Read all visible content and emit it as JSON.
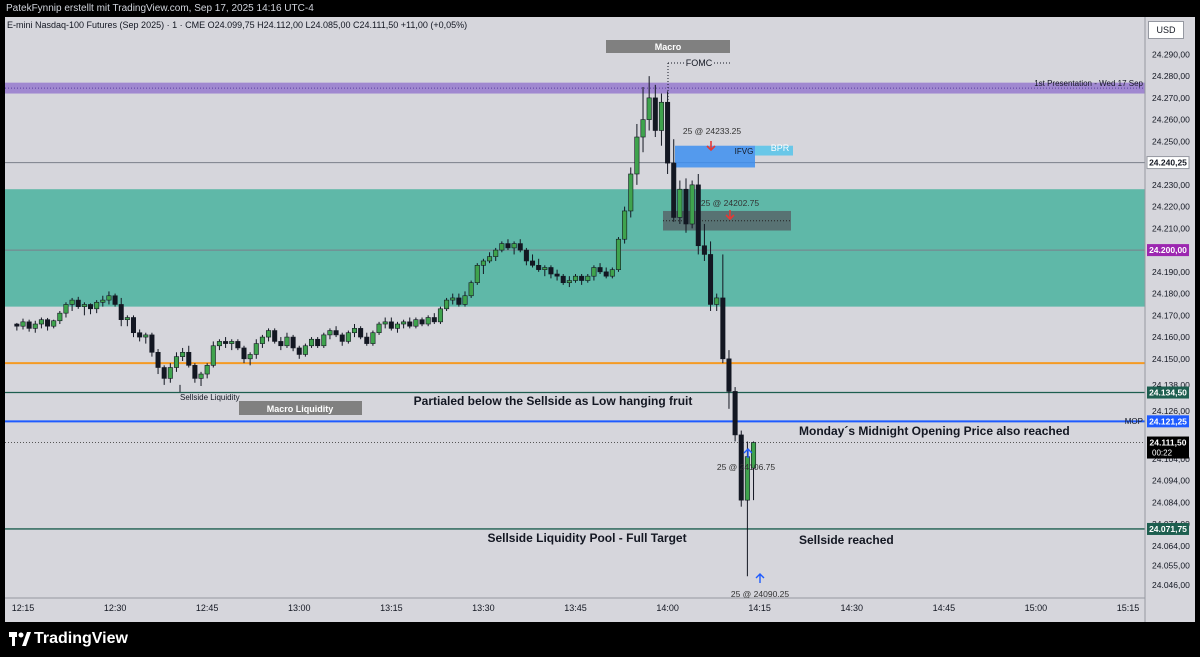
{
  "header": {
    "author_line": "PatekFynnip erstellt mit TradingView.com, Sep 17, 2025 14:16 UTC-4",
    "legend": "E-mini Nasdaq-100 Futures (Sep 2025) · 1 · CME  O24.099,75  H24.112,00  L24.085,00  C24.111,50  +11,00 (+0,05%)",
    "currency": "USD"
  },
  "footer": {
    "brand": "TradingView",
    "logo": "tradingview-logo-icon"
  },
  "colors": {
    "plot_bg": "#d6d6dc",
    "up": "#3fa34d",
    "down": "#131722",
    "zone": "#5fb8a8",
    "purple_band": "#9d84cf",
    "orange_line": "#f59a23",
    "blue_line": "#1e5bff",
    "dark_green_line": "#1d5e4f",
    "macro_box": "#808080"
  },
  "chart_data": {
    "type": "candlestick",
    "timeframe": "1",
    "y_ticks": [
      "24.290,00",
      "24.280,00",
      "24.270,00",
      "24.260,00",
      "24.250,00",
      "24.230,00",
      "24.220,00",
      "24.210,00",
      "24.190,00",
      "24.180,00",
      "24.170,00",
      "24.160,00",
      "24.150,00",
      "24.138,00",
      "24.126,00",
      "24.104,00",
      "24.094,00",
      "24.084,00",
      "24.074,00",
      "24.064,00",
      "24.055,00",
      "24.046,00"
    ],
    "x_ticks": [
      "12:15",
      "12:30",
      "12:45",
      "13:00",
      "13:15",
      "13:30",
      "13:45",
      "14:00",
      "14:15",
      "14:30",
      "14:45",
      "15:00",
      "15:15"
    ],
    "ylim": [
      24040,
      24298
    ],
    "x_tick_minutes": [
      735,
      750,
      765,
      780,
      795,
      810,
      825,
      840,
      855,
      870,
      885,
      900,
      915
    ],
    "candles_start_minute": 734,
    "candles": [
      [
        24166,
        24166.5,
        24163,
        24165
      ],
      [
        24165,
        24168.5,
        24163.5,
        24167
      ],
      [
        24167,
        24168,
        24162.5,
        24164
      ],
      [
        24164,
        24167.5,
        24162,
        24166
      ],
      [
        24166,
        24169,
        24164,
        24168
      ],
      [
        24168,
        24168.8,
        24163,
        24165
      ],
      [
        24165,
        24168,
        24164,
        24167.5
      ],
      [
        24167.5,
        24172,
        24166,
        24171
      ],
      [
        24171,
        24176,
        24169,
        24175
      ],
      [
        24175,
        24178,
        24172,
        24177
      ],
      [
        24177,
        24178.5,
        24173,
        24174
      ],
      [
        24174,
        24176,
        24170,
        24175
      ],
      [
        24175,
        24175.5,
        24170.5,
        24173
      ],
      [
        24173,
        24177,
        24171,
        24176
      ],
      [
        24176,
        24179,
        24174,
        24177
      ],
      [
        24177,
        24181,
        24175,
        24179
      ],
      [
        24179,
        24180,
        24174,
        24175
      ],
      [
        24175,
        24178,
        24165,
        24168
      ],
      [
        24168,
        24170,
        24165,
        24169
      ],
      [
        24169,
        24170,
        24160,
        24162
      ],
      [
        24162,
        24163.5,
        24158,
        24160
      ],
      [
        24160,
        24162,
        24157,
        24161
      ],
      [
        24161,
        24162,
        24151,
        24153
      ],
      [
        24153,
        24154.5,
        24143,
        24146
      ],
      [
        24146,
        24147,
        24138,
        24141
      ],
      [
        24141,
        24148,
        24139,
        24146
      ],
      [
        24146,
        24153,
        24144,
        24151
      ],
      [
        24151,
        24155,
        24149,
        24153
      ],
      [
        24153,
        24156,
        24146,
        24147
      ],
      [
        24147,
        24148,
        24139,
        24141
      ],
      [
        24141,
        24144,
        24137.5,
        24143
      ],
      [
        24143,
        24148,
        24141,
        24147
      ],
      [
        24147,
        24158,
        24146,
        24156
      ],
      [
        24156,
        24159,
        24154,
        24158
      ],
      [
        24158,
        24160,
        24155,
        24157
      ],
      [
        24157,
        24159,
        24154,
        24158
      ],
      [
        24158,
        24159,
        24154,
        24155
      ],
      [
        24155,
        24156,
        24148,
        24150
      ],
      [
        24150,
        24153,
        24147,
        24152
      ],
      [
        24152,
        24159,
        24150,
        24157
      ],
      [
        24157,
        24161,
        24155,
        24160
      ],
      [
        24160,
        24164,
        24158,
        24163
      ],
      [
        24163,
        24164,
        24157,
        24158
      ],
      [
        24158,
        24160,
        24154,
        24156
      ],
      [
        24156,
        24162,
        24155,
        24160
      ],
      [
        24160,
        24161,
        24153.5,
        24155
      ],
      [
        24155,
        24156,
        24150,
        24152
      ],
      [
        24152,
        24157,
        24151,
        24156
      ],
      [
        24156,
        24160,
        24155,
        24159
      ],
      [
        24159,
        24160,
        24155,
        24156
      ],
      [
        24156,
        24162,
        24155,
        24161
      ],
      [
        24161,
        24164,
        24159,
        24163
      ],
      [
        24163,
        24165,
        24160,
        24161
      ],
      [
        24161,
        24162,
        24156,
        24158
      ],
      [
        24158,
        24163,
        24157,
        24162
      ],
      [
        24162,
        24166,
        24160,
        24164
      ],
      [
        24164,
        24165,
        24159,
        24160
      ],
      [
        24160,
        24162,
        24156,
        24157
      ],
      [
        24157,
        24163,
        24156,
        24162
      ],
      [
        24162,
        24167,
        24161,
        24166
      ],
      [
        24166,
        24169,
        24164,
        24167
      ],
      [
        24167,
        24169,
        24163,
        24164
      ],
      [
        24164,
        24167,
        24162,
        24166
      ],
      [
        24166,
        24168,
        24164,
        24167
      ],
      [
        24167,
        24169,
        24164,
        24165
      ],
      [
        24165,
        24169,
        24164,
        24168
      ],
      [
        24168,
        24169,
        24165,
        24166
      ],
      [
        24166,
        24170,
        24165,
        24169
      ],
      [
        24169,
        24171,
        24166,
        24167
      ],
      [
        24167,
        24174,
        24166,
        24173
      ],
      [
        24173,
        24178,
        24172,
        24177
      ],
      [
        24177,
        24180,
        24175,
        24178
      ],
      [
        24178,
        24180,
        24174,
        24175
      ],
      [
        24175,
        24181,
        24174,
        24179
      ],
      [
        24179,
        24186,
        24178,
        24185
      ],
      [
        24185,
        24194,
        24184,
        24193
      ],
      [
        24193,
        24196,
        24189,
        24195
      ],
      [
        24195,
        24199,
        24194,
        24197
      ],
      [
        24197,
        24201,
        24195,
        24200
      ],
      [
        24200,
        24204,
        24199,
        24203
      ],
      [
        24203,
        24205,
        24200,
        24201
      ],
      [
        24201,
        24204,
        24198,
        24203
      ],
      [
        24203,
        24205,
        24199,
        24200
      ],
      [
        24200,
        24201,
        24193,
        24195
      ],
      [
        24195,
        24198,
        24192,
        24193
      ],
      [
        24193,
        24196,
        24190,
        24191
      ],
      [
        24191,
        24193,
        24188,
        24192
      ],
      [
        24192,
        24193,
        24187,
        24189
      ],
      [
        24189,
        24191,
        24186,
        24188
      ],
      [
        24188,
        24189,
        24184,
        24185
      ],
      [
        24185,
        24188,
        24183,
        24186
      ],
      [
        24186,
        24189,
        24185,
        24188
      ],
      [
        24188,
        24189,
        24184,
        24186
      ],
      [
        24186,
        24189,
        24185,
        24188
      ],
      [
        24188,
        24193,
        24186,
        24192
      ],
      [
        24192,
        24194,
        24189,
        24190
      ],
      [
        24190,
        24192,
        24187,
        24188
      ],
      [
        24188,
        24192,
        24187,
        24191
      ],
      [
        24191,
        24206,
        24190,
        24205
      ],
      [
        24205,
        24220,
        24203,
        24218
      ],
      [
        24218,
        24238,
        24215,
        24235
      ],
      [
        24235,
        24258,
        24230,
        24252
      ],
      [
        24252,
        24275,
        24245,
        24260
      ],
      [
        24260,
        24280,
        24255,
        24270
      ],
      [
        24270,
        24276,
        24252,
        24255
      ],
      [
        24255,
        24272,
        24248,
        24268
      ],
      [
        24268,
        24273,
        24235,
        24240
      ],
      [
        24240,
        24251,
        24213,
        24215
      ],
      [
        24215,
        24232,
        24212,
        24228
      ],
      [
        24228,
        24233,
        24208,
        24212
      ],
      [
        24212,
        24232,
        24210,
        24230
      ],
      [
        24230,
        24235,
        24198,
        24202
      ],
      [
        24202,
        24212,
        24195,
        24198
      ],
      [
        24198,
        24204,
        24172,
        24175
      ],
      [
        24175,
        24180,
        24172,
        24178
      ],
      [
        24178,
        24198,
        24148,
        24150
      ],
      [
        24150,
        24154,
        24127,
        24135
      ],
      [
        24135,
        24137,
        24112,
        24115
      ],
      [
        24115,
        24117,
        24082,
        24085
      ],
      [
        24085,
        24112,
        24050,
        24105
      ],
      [
        24099.75,
        24112,
        24085,
        24111.5
      ]
    ],
    "price_markers": [
      {
        "price": "24.240,25",
        "value": 24240.25,
        "label_bg": "#ffffff",
        "label_fg": "#131722"
      },
      {
        "price": "24.200,00",
        "value": 24200,
        "label_bg": "#9c27b0",
        "label_fg": "#ffffff"
      },
      {
        "price": "24.134,50",
        "value": 24134.5,
        "label_bg": "#1d5e4f",
        "label_fg": "#ffffff"
      },
      {
        "price": "24.121,25",
        "value": 24121.25,
        "label_bg": "#1e5bff",
        "label_fg": "#ffffff"
      },
      {
        "price": "24.111,50",
        "value": 24111.5,
        "label_bg": "#000000",
        "label_fg": "#ffffff",
        "sub": "00:22"
      },
      {
        "price": "24.071,75",
        "value": 24071.75,
        "label_bg": "#1d5e4f",
        "label_fg": "#ffffff"
      }
    ],
    "zones": [
      {
        "name": "teal-zone",
        "top": 24228,
        "bottom": 24174
      },
      {
        "name": "purple-band",
        "top": 24277,
        "bottom": 24272
      }
    ],
    "levels": [
      {
        "name": "orange-line",
        "value": 24148
      },
      {
        "name": "gray-line",
        "value": 24240.25
      },
      {
        "name": "gray-line-2",
        "value": 24200
      },
      {
        "name": "green-line-1",
        "value": 24134.5
      },
      {
        "name": "blue-line-mop",
        "value": 24121.25
      },
      {
        "name": "green-line-2",
        "value": 24071.75
      }
    ],
    "annotations": {
      "macro": "Macro",
      "fomc": "FOMC",
      "presentation": "1st Presentation - Wed 17 Sep",
      "bpr": "BPR",
      "ifvg": "IFVG",
      "sellside_liquidity": "Sellside Liquidity",
      "macro_liquidity": "Macro Liquidity",
      "partialed": "Partialed below the Sellside as Low hanging fruit",
      "mop_text": "Monday´s Midnight Opening Price also reached",
      "mop_tag": "MOP",
      "pool": "Sellside Liquidity Pool - Full Target",
      "sellside_reached": "Sellside reached",
      "trade1": "25 @ 24233.25",
      "trade2": "25 @ 24202.75",
      "trade3": "25 @ 24106.75",
      "trade4": "25 @ 24090.25"
    }
  }
}
